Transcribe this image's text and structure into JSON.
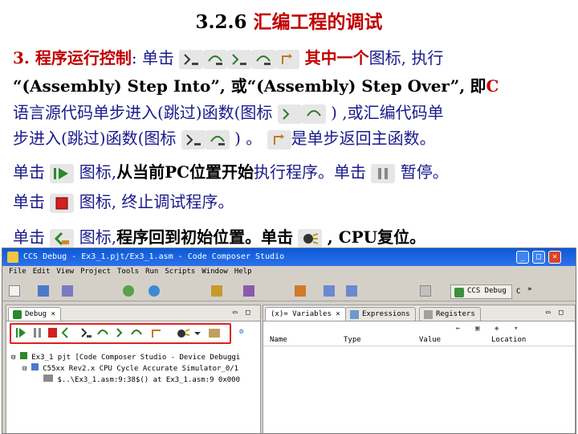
{
  "slide": {
    "title_num": "3.2.6",
    "title_text": "汇编工程的调试",
    "l1_lead": "3. 程序运行控制",
    "l1_colon": ": 单击",
    "l1_tail_a": "其中一个",
    "l1_tail_b": "图标, 执行",
    "l2": "“(Assembly) Step Into”, 或“(Assembly) Step Over”,",
    "l2_tail": "即",
    "l2_c": "C",
    "l3_a": "语言源代码单步进入(跳过)函数(图标",
    "l3_b": ") ,或汇编代码单",
    "l4_a": "步进入(跳过)函数(图标",
    "l4_b": ") 。",
    "l4_c": "是单步返回主函数。",
    "l5_a": "单击",
    "l5_b": "图标,",
    "l5_c": "从当前PC位置开始",
    "l5_d": "执行程序。单击",
    "l5_e": "暂停。",
    "l6_a": "单击",
    "l6_b": "图标, 终止调试程序。",
    "l7_a": "单击",
    "l7_b": "图标,",
    "l7_c": "程序回到初始位置。单击",
    "l7_d": ", CPU复位。"
  },
  "window": {
    "title": "CCS Debug - Ex3_1.pjt/Ex3_1.asm - Code Composer Studio",
    "menus": [
      "File",
      "Edit",
      "View",
      "Project",
      "Tools",
      "Run",
      "Scripts",
      "Window",
      "Help"
    ],
    "perspective": "CCS Debug",
    "perspective_more": "C",
    "debug_tab": "Debug",
    "var_tabs": [
      "(x)= Variables",
      "Expressions",
      "Registers"
    ],
    "columns": [
      "Name",
      "Type",
      "Value",
      "Location"
    ],
    "tree": [
      "Ex3_1 pjt [Code Composer Studio - Device Debuggi",
      "C55xx Rev2.x CPU Cycle Accurate Simulator_0/1",
      "$..\\Ex3_1.asm:9:38$() at Ex3_1.asm:9 0x000"
    ]
  },
  "colors": {
    "accent": "#1a1a8c",
    "highlight": "#c00000",
    "frame": "#e02020"
  },
  "icons": [
    "step-into-icon",
    "step-over-icon",
    "step-return-icon",
    "run-icon",
    "pause-icon",
    "terminate-icon",
    "restart-icon",
    "reset-cpu-icon"
  ]
}
